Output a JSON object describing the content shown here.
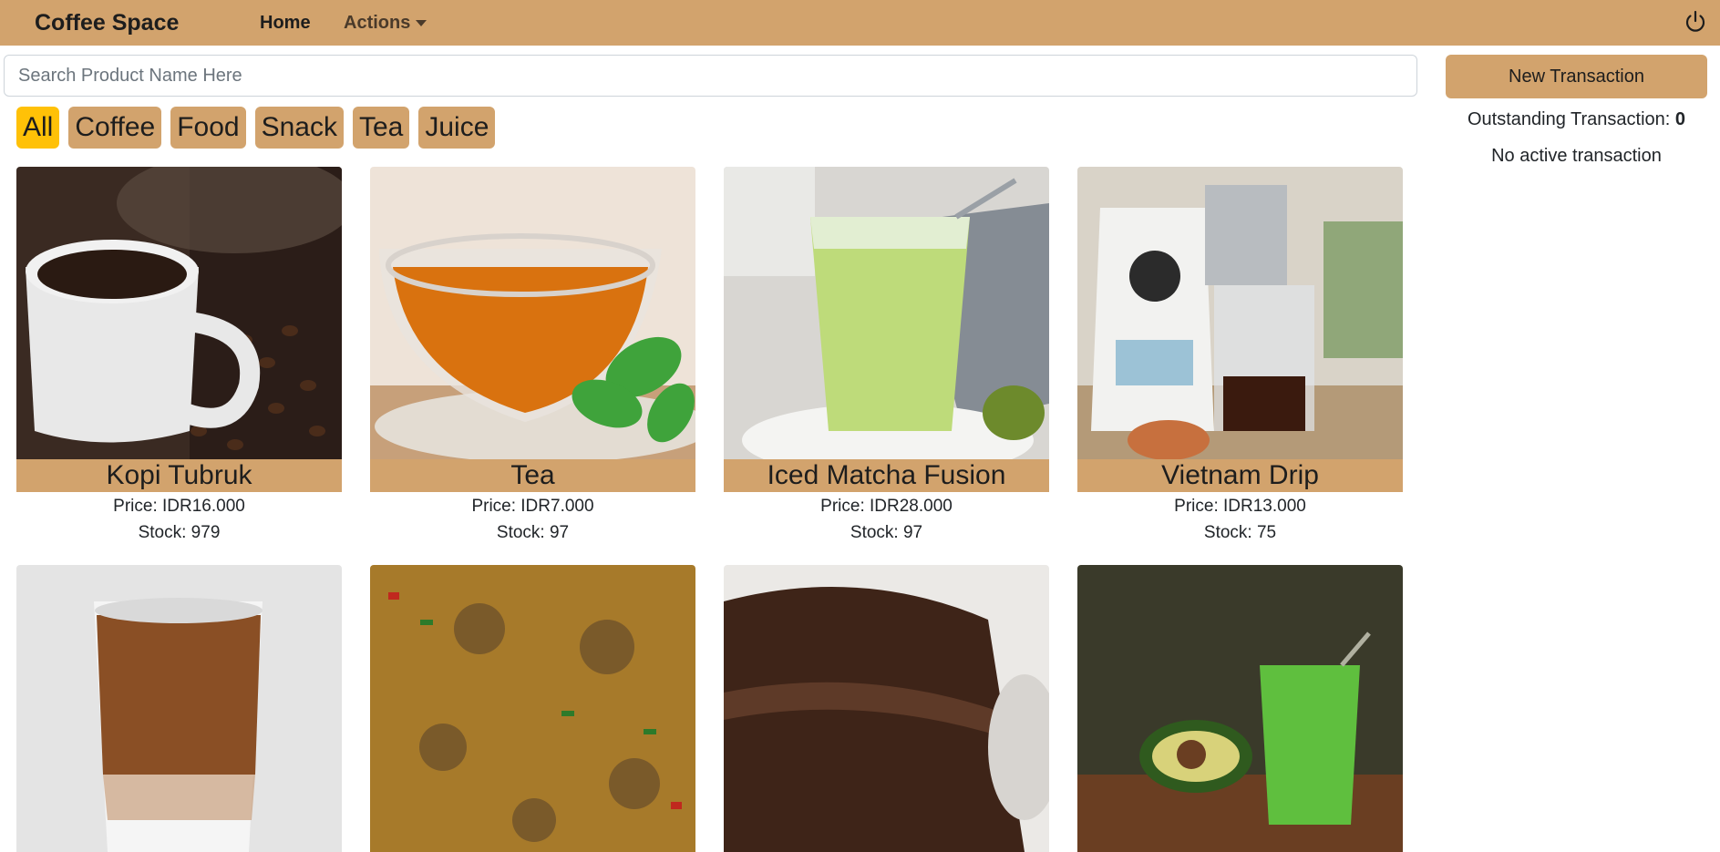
{
  "navbar": {
    "brand": "Coffee Space",
    "home_label": "Home",
    "actions_label": "Actions",
    "power_icon": "power-icon",
    "bg_color": "#d2a36d"
  },
  "search": {
    "placeholder": "Search Product Name Here",
    "value": ""
  },
  "categories": [
    {
      "label": "All",
      "active": true
    },
    {
      "label": "Coffee",
      "active": false
    },
    {
      "label": "Food",
      "active": false
    },
    {
      "label": "Snack",
      "active": false
    },
    {
      "label": "Tea",
      "active": false
    },
    {
      "label": "Juice",
      "active": false
    }
  ],
  "products": [
    {
      "name": "Kopi Tubruk",
      "price": "Price: IDR16.000",
      "stock": "Stock: 979",
      "image": "coffee-cup-photo"
    },
    {
      "name": "Tea",
      "price": "Price: IDR7.000",
      "stock": "Stock: 97",
      "image": "tea-cup-photo"
    },
    {
      "name": "Iced Matcha Fusion",
      "price": "Price: IDR28.000",
      "stock": "Stock: 97",
      "image": "iced-matcha-photo"
    },
    {
      "name": "Vietnam Drip",
      "price": "Price: IDR13.000",
      "stock": "Stock: 75",
      "image": "vietnam-drip-photo"
    },
    {
      "name": "",
      "price": "",
      "stock": "",
      "image": "iced-latte-photo"
    },
    {
      "name": "",
      "price": "",
      "stock": "",
      "image": "fried-rice-photo"
    },
    {
      "name": "",
      "price": "",
      "stock": "",
      "image": "chocolate-cake-photo"
    },
    {
      "name": "",
      "price": "",
      "stock": "",
      "image": "avocado-juice-photo"
    }
  ],
  "panel": {
    "new_transaction_label": "New Transaction",
    "outstanding_label": "Outstanding Transaction: ",
    "outstanding_count": "0",
    "no_active_text": "No active transaction"
  },
  "colors": {
    "accent": "#d2a36d",
    "active_chip": "#ffc107"
  }
}
